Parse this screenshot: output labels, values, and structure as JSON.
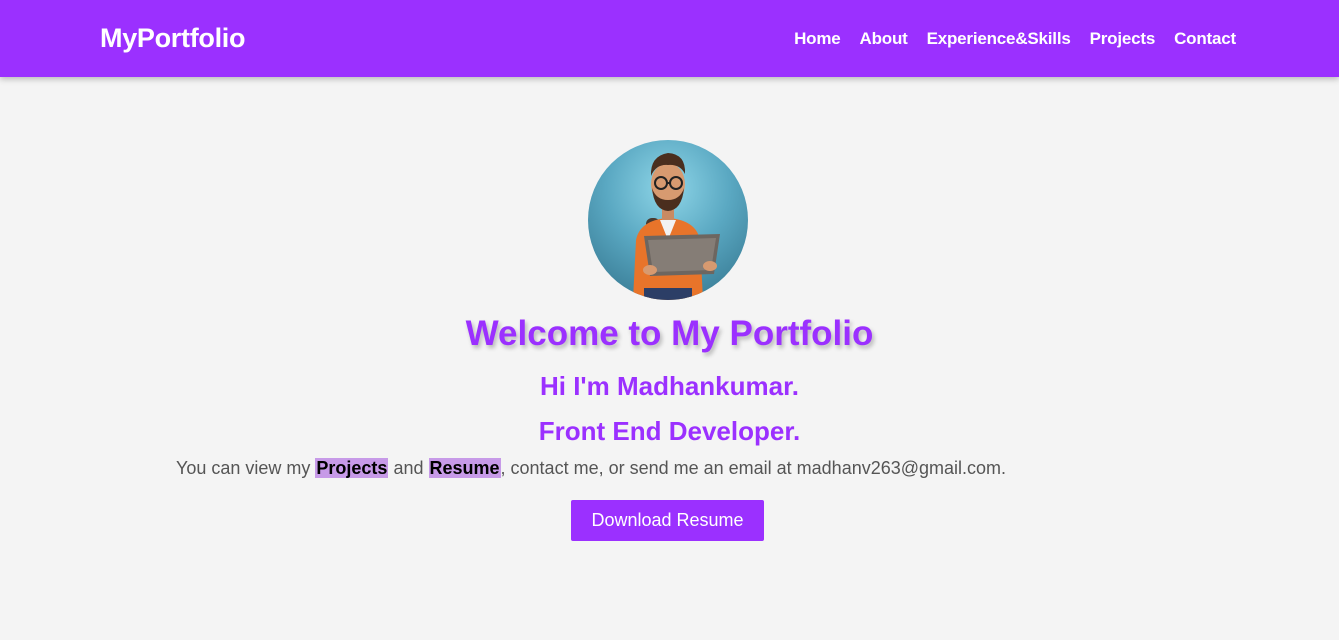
{
  "navbar": {
    "brand": "MyPortfolio",
    "links": [
      "Home",
      "About",
      "Experience&Skills",
      "Projects",
      "Contact"
    ]
  },
  "hero": {
    "avatar_icon": "developer-avatar",
    "welcome": "Welcome to My Portfolio",
    "greeting": "Hi I'm Madhankumar.",
    "role": "Front End Developer.",
    "info": {
      "prefix": "You can view my ",
      "projects_link": "Projects",
      "and": " and ",
      "resume_link": "Resume",
      "suffix": ", contact me, or send me an email at madhanv263@gmail.com."
    },
    "download_button": "Download Resume"
  },
  "colors": {
    "accent": "#9b30ff",
    "background": "#f4f4f4",
    "highlight": "#c79ae8",
    "body_text": "#555555"
  }
}
